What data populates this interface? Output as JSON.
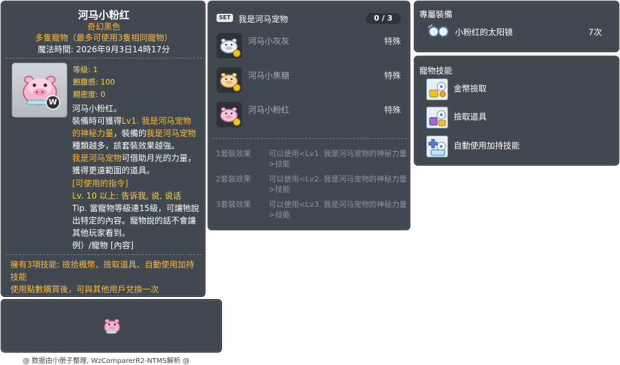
{
  "item_code": "05002686",
  "item": {
    "name": "河马小粉红",
    "subtitle1": "奇幻黑色",
    "subtitle2": "多隻寵物（最多可使用3隻相同寵物）",
    "expire": "魔法時間: 2026年9月3日14時17分",
    "stats": {
      "level": "等级: 1",
      "fullness": "飽腹感: 100",
      "closeness": "親密度: 0"
    },
    "coin_badge": "W",
    "desc": {
      "l1": "河马小粉红。",
      "l2a": "裝備時可獲得",
      "l2b": "Lv1. 我是河马宠物",
      "l3a": "的神秘力量",
      "l3b": "，裝備的",
      "l3c": "我是河马宠物",
      "l4": "種類越多，該套裝效果越強。",
      "l5a": "我是河马宠物",
      "l5b": "可借助月光的力量，",
      "l6": "獲得更遠範圍的道具。",
      "cmd_title": "[可使用的指令]",
      "cmd_body": "Lv. 10 以上: 告诉我, 说, 说话",
      "cmd_body2": "Tip. 當寵物等級達15級，可讓牠說出特定的內容。寵物說的話不會讓其他玩家看到。",
      "cmd_example": "例）/寵物 [內容]"
    },
    "skills_summary": "擁有3項技能: 撿拾楓幣、撿取道具、自動使用加持技能",
    "trade_note": "使用點數購買後，可與其他用戶兌換一次"
  },
  "set": {
    "badge": "SET",
    "title": "我是河马宠物",
    "count": "0 / 3",
    "items": [
      {
        "name": "河马小灰灰",
        "type": "特殊",
        "color": "#e9eef3"
      },
      {
        "name": "河马小焦糖",
        "type": "特殊",
        "color": "#f5dcaa"
      },
      {
        "name": "河马小粉红",
        "type": "特殊",
        "color": "#f8c8d8"
      }
    ],
    "effects": [
      {
        "label": "1套裝效果",
        "text": "可以使用<Lv1. 我是河马宠物的神秘力量>技能"
      },
      {
        "label": "2套裝效果",
        "text": "可以使用<Lv2. 我是河马宠物的神秘力量>技能"
      },
      {
        "label": "3套裝效果",
        "text": "可以使用<Lv3. 我是河马宠物的神秘力量>技能"
      }
    ]
  },
  "exclusive": {
    "title": "專屬裝備",
    "item_name": "小粉红的太阳镜",
    "count": "7次"
  },
  "pet_skills": {
    "title": "寵物技能",
    "items": [
      {
        "label": "金幣撿取",
        "icon": "coin-pickup-icon"
      },
      {
        "label": "撿取道具",
        "icon": "item-pickup-icon"
      },
      {
        "label": "自動使用加持技能",
        "icon": "auto-buff-icon"
      }
    ]
  },
  "footer": "@ 数据由小册子整理, WzComparerR2-NTMS解析 @"
}
